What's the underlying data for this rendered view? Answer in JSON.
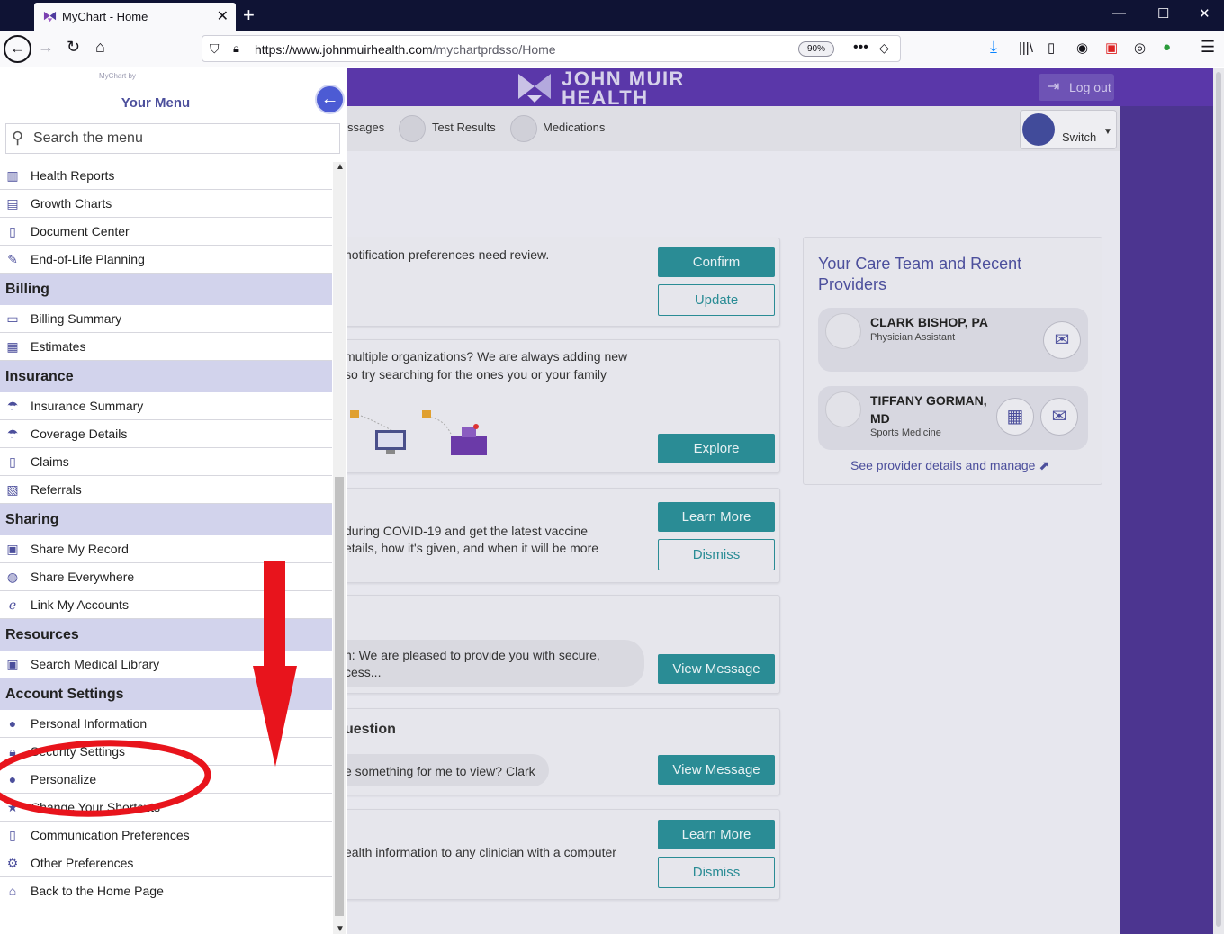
{
  "browser": {
    "tab_title": "MyChart - Home",
    "url_domain": "https://www.johnmuirhealth.com",
    "url_path": "/mychartprdsso/Home",
    "zoom": "90%"
  },
  "header": {
    "logo_line1": "JOHN MUIR",
    "logo_line2": "HEALTH",
    "logout": "Log out"
  },
  "nav": {
    "messages": "ssages",
    "test_results": "Test Results",
    "medications": "Medications",
    "switch": "Switch"
  },
  "cards": [
    {
      "text": "notification preferences need review.",
      "buttons": [
        "Confirm",
        "Update"
      ]
    },
    {
      "text1": "multiple organizations? We are always adding new",
      "text2": "so try searching for the ones you or your family",
      "button": "Explore"
    },
    {
      "text1": "during COVID-19 and get the latest vaccine",
      "text2": "etails, how it's given, and when it will be more",
      "buttons": [
        "Learn More",
        "Dismiss"
      ]
    },
    {
      "text1": "n: We are pleased to provide you with secure,",
      "text2": "cess...",
      "button": "View Message"
    },
    {
      "title": "uestion",
      "text": "e something for me to view? Clark",
      "button": "View Message"
    },
    {
      "text": "ealth information to any clinician with a computer",
      "buttons": [
        "Learn More",
        "Dismiss"
      ]
    }
  ],
  "care_team": {
    "title": "Your Care Team and Recent Providers",
    "providers": [
      {
        "name": "CLARK BISHOP, PA",
        "role": "Physician Assistant"
      },
      {
        "name1": "TIFFANY GORMAN,",
        "name2": "MD",
        "role": "Sports Medicine"
      }
    ],
    "link": "See provider details and manage"
  },
  "menu": {
    "by": "MyChart by",
    "title": "Your Menu",
    "search_placeholder": "Search the menu",
    "items": {
      "health_reports": "Health Reports",
      "growth_charts": "Growth Charts",
      "document_center": "Document Center",
      "end_of_life": "End-of-Life Planning",
      "billing": "Billing",
      "billing_summary": "Billing Summary",
      "estimates": "Estimates",
      "insurance": "Insurance",
      "insurance_summary": "Insurance Summary",
      "coverage_details": "Coverage Details",
      "claims": "Claims",
      "referrals": "Referrals",
      "sharing": "Sharing",
      "share_my_record": "Share My Record",
      "share_everywhere": "Share Everywhere",
      "link_my_accounts": "Link My Accounts",
      "resources": "Resources",
      "search_medical_library": "Search Medical Library",
      "account_settings": "Account Settings",
      "personal_information": "Personal Information",
      "security_settings": "Security Settings",
      "personalize": "Personalize",
      "change_shortcuts": "Change Your Shortcuts",
      "communication_preferences": "Communication Preferences",
      "other_preferences": "Other Preferences",
      "back_home": "Back to the Home Page"
    }
  },
  "colors": {
    "brand_purple": "#5a37a9",
    "accent_blue": "#4c4f9c",
    "teal": "#2a8c95",
    "section_bg": "#d2d3ec",
    "annotation_red": "#e8141c"
  }
}
